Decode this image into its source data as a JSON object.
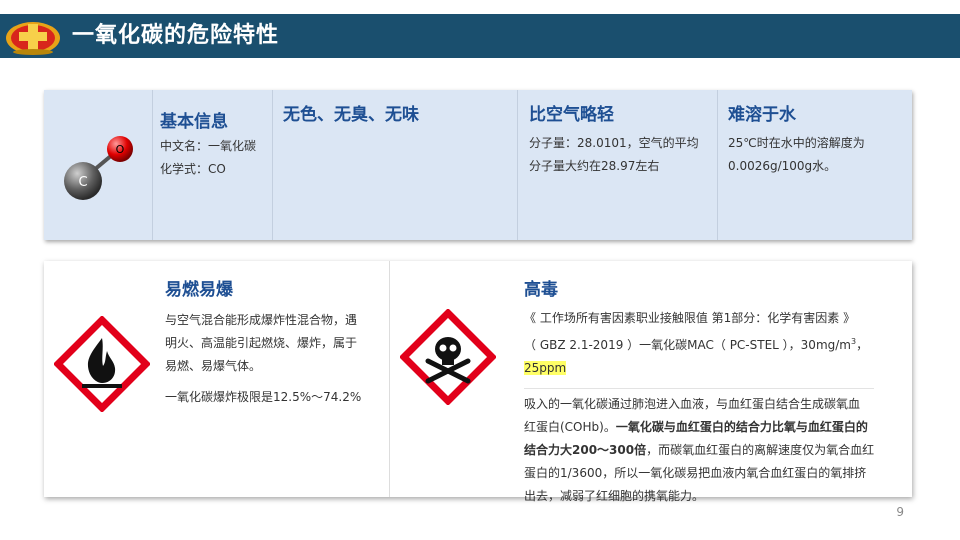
{
  "header": {
    "title": "一氧化碳的危险特性"
  },
  "basic": {
    "title": "基本信息",
    "lines": [
      "中文名：一氧化碳",
      "化学式：CO"
    ],
    "atoms": {
      "oxygen": "O",
      "carbon": "C"
    }
  },
  "color": {
    "title": "无色、无臭、无味"
  },
  "lighter": {
    "title": "比空气略轻",
    "lines": [
      "分子量：28.0101，空气的平均",
      "分子量大约在28.97左右"
    ]
  },
  "insoluble": {
    "title": "难溶于水",
    "lines": [
      "25℃时在水中的溶解度为",
      "0.0026g/100g水。"
    ]
  },
  "flammable": {
    "title": "易燃易爆",
    "lines": [
      "与空气混合能形成爆炸性混合物，遇",
      "明火、高温能引起燃烧、爆炸，属于",
      "易燃、易爆气体。"
    ],
    "limit": "一氧化碳爆炸极限是12.5%～74.2%"
  },
  "toxic": {
    "title": "高毒",
    "std_line1": "《 工作场所有害因素职业接触限值 第1部分：化学有害因素 》",
    "std_line2a": "（ GBZ 2.1-2019 ）一氧化碳MAC（ PC-STEL ），30mg/m",
    "std_sup": "3",
    "std_line2b": "，",
    "std_line3": "25ppm",
    "p_line1": "吸入的一氧化碳通过肺泡进入血液，与血红蛋白结合生成碳氧血",
    "p_line2a": "红蛋白(COHb)。",
    "p_line2b": "一氧化碳与血红蛋白的结合力比氧与血红蛋白的",
    "p_line3a": "结合力大200～300倍",
    "p_line3b": "，而碳氧血红蛋白的离解速度仅为氧合血红",
    "p_line4": "蛋白的1/3600，所以一氧化碳易把血液内氧合血红蛋白的氧排挤",
    "p_line5": "出去，减弱了红细胞的携氧能力。"
  },
  "page": {
    "number": "9"
  },
  "colors": {
    "header": "#1a4f6e",
    "heading": "#1e4f93",
    "panel": "#dbe6f4",
    "hazard_red": "#e2001a",
    "highlight": "#ffff66"
  }
}
